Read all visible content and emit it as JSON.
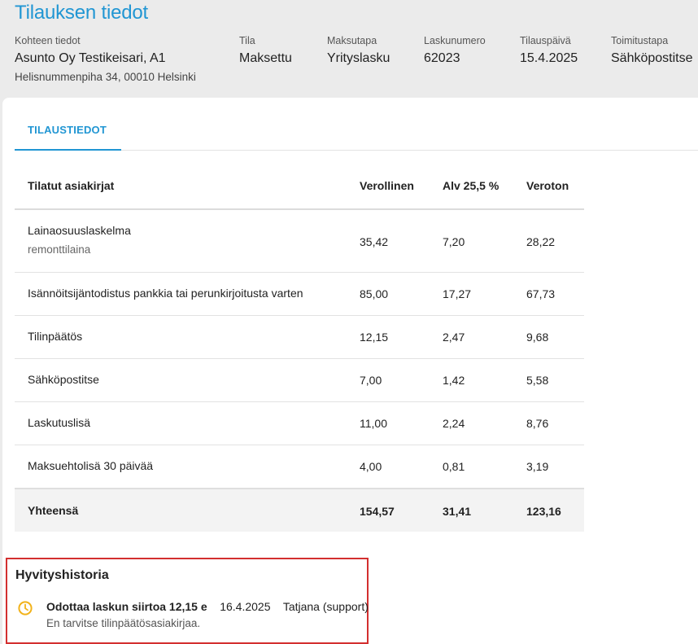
{
  "page": {
    "title": "Tilauksen tiedot"
  },
  "info": [
    {
      "label": "Kohteen tiedot",
      "value": "Asunto Oy Testikeisari, A1",
      "sub": "Helisnummenpiha 34, 00010 Helsinki"
    },
    {
      "label": "Tila",
      "value": "Maksettu"
    },
    {
      "label": "Maksutapa",
      "value": "Yrityslasku"
    },
    {
      "label": "Laskunumero",
      "value": "62023"
    },
    {
      "label": "Tilauspäivä",
      "value": "15.4.2025"
    },
    {
      "label": "Toimitustapa",
      "value": "Sähköpostitse"
    }
  ],
  "tabs": [
    {
      "label": "TILAUSTIEDOT",
      "active": true
    }
  ],
  "table": {
    "headers": [
      "Tilatut asiakirjat",
      "Verollinen",
      "Alv 25,5 %",
      "Veroton"
    ],
    "rows": [
      {
        "name": "Lainaosuuslaskelma",
        "sub": "remonttilaina",
        "gross": "35,42",
        "vat": "7,20",
        "net": "28,22"
      },
      {
        "name": "Isännöitsijäntodistus pankkia tai perunkirjoitusta varten",
        "gross": "85,00",
        "vat": "17,27",
        "net": "67,73"
      },
      {
        "name": "Tilinpäätös",
        "gross": "12,15",
        "vat": "2,47",
        "net": "9,68"
      },
      {
        "name": "Sähköpostitse",
        "gross": "7,00",
        "vat": "1,42",
        "net": "5,58"
      },
      {
        "name": "Laskutuslisä",
        "gross": "11,00",
        "vat": "2,24",
        "net": "8,76"
      },
      {
        "name": "Maksuehtolisä 30 päivää",
        "gross": "4,00",
        "vat": "0,81",
        "net": "3,19"
      }
    ],
    "total": {
      "name": "Yhteensä",
      "gross": "154,57",
      "vat": "31,41",
      "net": "123,16"
    }
  },
  "refund_history": {
    "title": "Hyvityshistoria",
    "icon": "clock-icon",
    "icon_color": "#f2b21a",
    "entry": {
      "status": "Odottaa laskun siirtoa 12,15 e",
      "date": "16.4.2025",
      "user": "Tatjana (support)",
      "note": "En tarvitse tilinpäätösasiakirjaa."
    }
  },
  "colors": {
    "accent": "#2196d3",
    "highlight_border": "#d32f2f"
  }
}
